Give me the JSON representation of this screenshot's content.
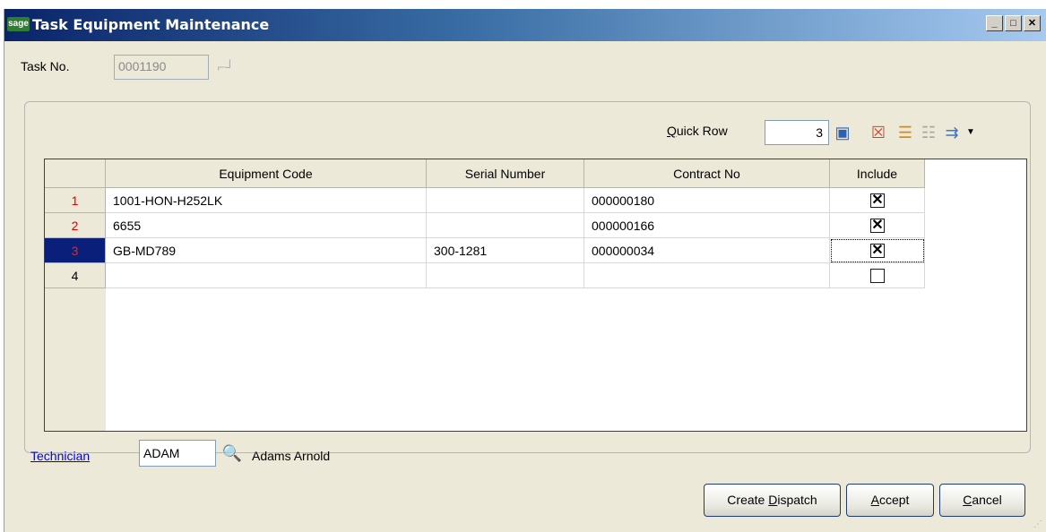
{
  "window": {
    "title": "Task Equipment Maintenance",
    "app_icon": "sage",
    "controls": [
      "minimize-icon",
      "maximize-icon",
      "close-icon"
    ]
  },
  "task": {
    "label": "Task No.",
    "value": "0001190"
  },
  "quick_row": {
    "label_prefix": "",
    "label_accel": "Q",
    "label_rest": "uick Row",
    "value": "3"
  },
  "toolbar_icons": [
    "quickrow-lookup-icon",
    "delete-row-icon",
    "insert-row-icon",
    "customize-grid-icon",
    "more-options-icon"
  ],
  "grid": {
    "columns": [
      "Equipment Code",
      "Serial Number",
      "Contract No",
      "Include"
    ],
    "rows": [
      {
        "num": "1",
        "equipment_code": "1001-HON-H252LK",
        "serial_number": "",
        "contract_no": "000000180",
        "include": true
      },
      {
        "num": "2",
        "equipment_code": "6655",
        "serial_number": "",
        "contract_no": "000000166",
        "include": true
      },
      {
        "num": "3",
        "equipment_code": "GB-MD789",
        "serial_number": "300-1281",
        "contract_no": "000000034",
        "include": true
      },
      {
        "num": "4",
        "equipment_code": "",
        "serial_number": "",
        "contract_no": "",
        "include": false
      }
    ],
    "current_row": 3
  },
  "technician": {
    "label": "Technician",
    "code": "ADAM",
    "name": "Adams Arnold"
  },
  "buttons": {
    "create_dispatch_pre": "Create ",
    "create_dispatch_accel": "D",
    "create_dispatch_post": "ispatch",
    "accept_accel": "A",
    "accept_post": "ccept",
    "cancel_accel": "C",
    "cancel_post": "ancel"
  }
}
